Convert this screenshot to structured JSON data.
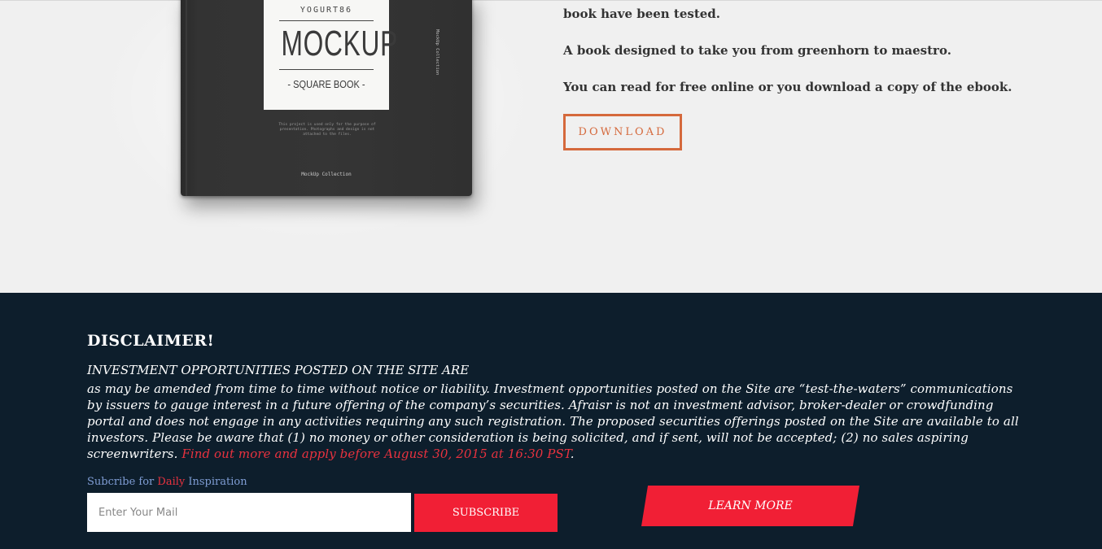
{
  "book": {
    "brand": "YOGURT86",
    "title": "MOCKUP",
    "subtitle": "- SQUARE BOOK -",
    "small_text": "This project is used only for the purpose of presentation. Photographs and design is not attached to the files.",
    "collection": "MockUp Collection",
    "spine": "MockUp Collection"
  },
  "copy": {
    "line1": "book have been tested.",
    "line2": "A book designed to take you from greenhorn to maestro.",
    "line3": "You can read for free online or you download a copy of the ebook."
  },
  "download_label": "DOWNLOAD",
  "disclaimer": {
    "title": "DISCLAIMER!",
    "heading": "INVESTMENT OPPORTUNITIES POSTED ON THE SITE ARE",
    "body": "as may be amended from time to time without notice or liability. Investment opportunities posted on the Site are “test-the-waters” communications by issuers to gauge interest in a future offering of the company’s securities. Afraisr is not an investment advisor, broker-dealer or crowdfunding portal and does not engage in any activities requiring any such registration. The proposed securities offerings posted on the Site are available to all investors. Please be aware that (1) no money or other consideration is being solicited, and if sent, will not be accepted; (2) no sales aspiring screenwriters.",
    "link": "Find out more and apply before August 30, 2015 at 16:30 PST",
    "end": "."
  },
  "subscribe": {
    "label_pre": "Subcribe for ",
    "label_accent": "Daily",
    "label_post": " Inspiration",
    "placeholder": "Enter Your Mail",
    "button": "SUBSCRIBE"
  },
  "learn_more": "LEARN MORE",
  "colors": {
    "accent_red": "#f11f35",
    "download_orange": "#d5693c",
    "footer_bg": "#0d1e2c",
    "label_blue": "#7f9dd4"
  }
}
